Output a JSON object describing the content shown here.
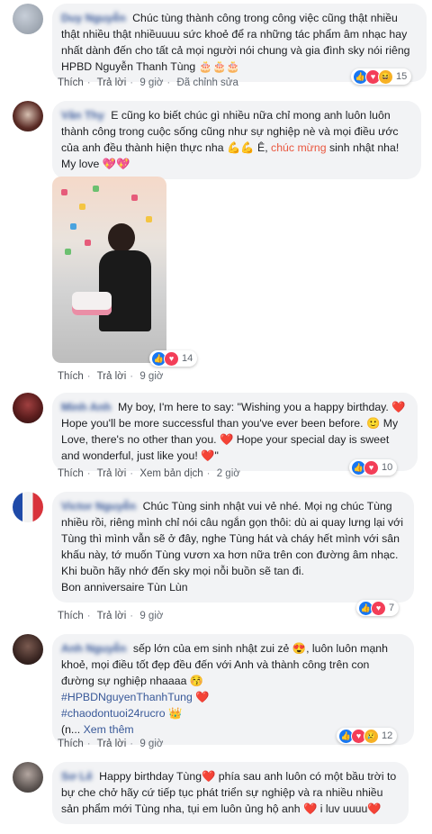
{
  "comments": [
    {
      "name": "Duy Nguyễn",
      "text": "Chúc tùng thành công trong công việc cũng thật nhiều thật nhiều thật nhiềuuuu sức khoẻ để ra những tác phẩm âm nhạc hay nhất dành đến cho tất cả mọi người nói chung và gia đình sky nói riêng HPBD Nguyễn Thanh Tùng",
      "emoji": "🎂🎂🎂",
      "actions": {
        "like": "Thích",
        "reply": "Trả lời",
        "time": "9 giờ",
        "edited": "Đã chỉnh sửa"
      },
      "reaction_count": "15"
    },
    {
      "name": "Vân Thy",
      "text_a": "E cũng ko biết chúc gì nhiều nữa chỉ mong anh luôn luôn thành công trong cuộc sống cũng như sự nghiệp nè và mọi điều ước của anh đều thành hiện thực nha",
      "emoji_a": "💪💪",
      "text_b": " Ê, ",
      "highlight": "chúc mừng",
      "text_c": " sinh nhật nha! My love",
      "emoji_b": "💖💖",
      "actions": {
        "like": "Thích",
        "reply": "Trả lời",
        "time": "9 giờ"
      },
      "reaction_count": "14"
    },
    {
      "name": "Minh Anh",
      "text_a": "My boy, I'm here to say: \"Wishing you a happy birthday.",
      "text_b": "Hope you'll be more successful than you've ever been before.",
      "text_c": "My Love, there's no other than you.",
      "text_d": "Hope your special day is sweet and wonderful, just like you!",
      "text_e": "\"",
      "actions": {
        "like": "Thích",
        "reply": "Trả lời",
        "translate": "Xem bản dịch",
        "time": "2 giờ"
      },
      "reaction_count": "10"
    },
    {
      "name": "Victor Nguyễn",
      "text": "Chúc Tùng sinh nhật vui vẻ nhé. Mọi ng chúc Tùng nhiều rồi, riêng mình chỉ nói câu ngắn gọn thôi: dù ai quay lưng lại với Tùng thì mình vẫn sẽ ở đây, nghe Tùng hát và cháy hết mình với sân khấu này, tớ muốn Tùng vươn xa hơn nữa trên con đường âm nhạc. Khi buồn hãy nhớ đến sky mọi nỗi buồn sẽ tan đi.",
      "text_2": "Bon anniversaire Tùn Lùn",
      "actions": {
        "like": "Thích",
        "reply": "Trả lời",
        "time": "9 giờ"
      },
      "reaction_count": "7"
    },
    {
      "name": "Anh Nguyễn",
      "text_a": "sếp lớn của em sinh nhật zui zẻ",
      "text_b": ", luôn luôn mạnh khoẻ, mọi điều tốt đẹp đều đến với Anh và thành công trên con đường sự nghiệp nhaaaa",
      "hashtag_1": "#HPBDNguyenThanhTung",
      "hashtag_2": "#chaodontuoi24rucro",
      "ellipsis": "(n...",
      "see_more": "Xem thêm",
      "actions": {
        "like": "Thích",
        "reply": "Trả lời",
        "time": "9 giờ"
      },
      "reaction_count": "12"
    },
    {
      "name": "Sơ Lê",
      "text_a": "Happy birthday Tùng",
      "text_b": " phía sau anh luôn có một bầu trời to bự che chở hãy cứ tiếp tục phát triển sự nghiệp và ra nhiều nhiều sản phẩm mới Tùng nha, tụi em luôn ủng hộ anh",
      "text_c": " i luv uuuu"
    }
  ]
}
